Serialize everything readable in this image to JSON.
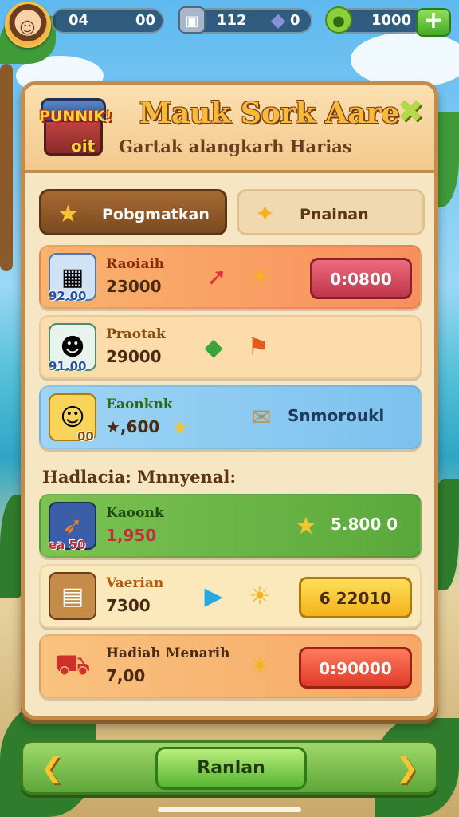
{
  "hud": {
    "avatar_icon": "player-avatar",
    "stat_1": {
      "left": "04",
      "right": "00"
    },
    "gems": {
      "icon": "chest-icon",
      "value": "112"
    },
    "diamonds": {
      "icon": "diamond-icon",
      "value": "0"
    },
    "coins": {
      "icon": "coin-icon",
      "value": "1000"
    },
    "add_label": "+"
  },
  "panel": {
    "badge_line1": "PUNNIK!",
    "badge_line2": "oit",
    "title": "Mauk Sork Aare",
    "subtitle": "Gartak alangkarh Harias",
    "close_label": "✖"
  },
  "tabs": [
    {
      "label": "Pobgmatkan",
      "icon": "star-icon",
      "active": true
    },
    {
      "label": "Pnainan",
      "icon": "star-icon",
      "active": false
    }
  ],
  "daily_rows": [
    {
      "name": "Raoiaih",
      "amount": "23000",
      "qty": "92.00",
      "claim": "0:0800",
      "color": "#f9a45f"
    },
    {
      "name": "Praotak",
      "amount": "29000",
      "qty": "91.00",
      "claim": "",
      "color": "#fbd9a5"
    },
    {
      "name": "Eaonknk",
      "amount": "★,600",
      "qty": "00",
      "value": "Snmoroukl",
      "color": "#8fcdf2"
    }
  ],
  "section_title": "Hadlacia: Mnnyenal:",
  "mystery_rows": [
    {
      "name": "Kaoonk",
      "amount": "1,950",
      "qty": "ea 50",
      "value": "5.800 0",
      "color": "#6db74a"
    },
    {
      "name": "Vaerian",
      "amount": "7300",
      "qty": "",
      "claim": "6 22010",
      "color": "#fbe7b5"
    },
    {
      "name": "Hadiah Menarih",
      "amount": "7,00",
      "qty": "",
      "claim": "0:90000",
      "color": "#f8b070"
    }
  ],
  "bottom": {
    "prev_label": "❮",
    "main_label": "Ranlan",
    "next_label": "❯"
  }
}
